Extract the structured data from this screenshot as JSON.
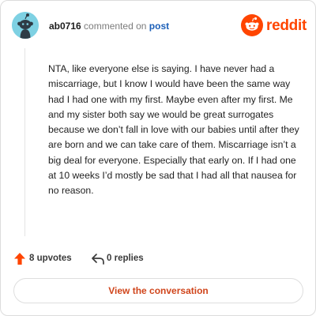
{
  "header": {
    "username": "ab0716",
    "action": "commented on",
    "post_link": "post",
    "brand": "reddit"
  },
  "comment": {
    "body": "NTA, like everyone else is saying. I have never had a miscarriage, but I know I would have been the same way had I had one with my first. Maybe even after my first. Me and my sister both say we would be great surrogates because we don’t fall in love with our babies until after they are born and we can take care of them. Miscarriage isn’t a big deal for everyone. Especially that early on. If I had one at 10 weeks I’d mostly be sad that I had all that nausea for no reason."
  },
  "actions": {
    "upvotes": "8 upvotes",
    "replies": "0 replies"
  },
  "cta": {
    "label": "View the conversation"
  },
  "colors": {
    "brand_orange": "#ff4500",
    "link_blue": "#1b5fb8",
    "avatar_bg": "#7ed1e3",
    "cta_text": "#d0451b"
  },
  "icons": {
    "avatar": "snoo-avatar-icon",
    "brand": "reddit-logo-icon",
    "upvote": "upvote-arrow-icon",
    "reply": "reply-arrow-icon"
  }
}
